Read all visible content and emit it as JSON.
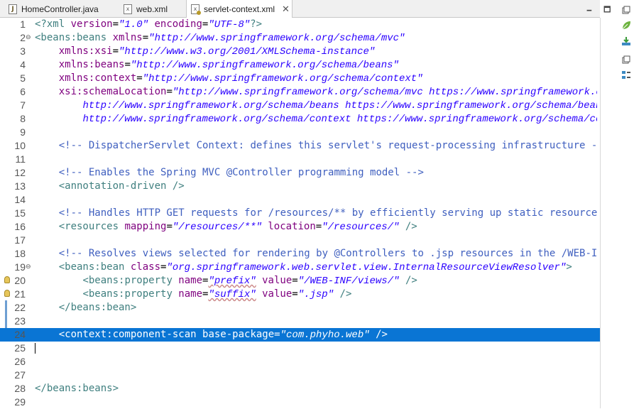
{
  "tabs": [
    {
      "label": "HomeController.java",
      "kind": "java",
      "icon": "java-file-icon"
    },
    {
      "label": "web.xml",
      "kind": "xml",
      "icon": "xml-file-icon"
    },
    {
      "label": "servlet-context.xml",
      "kind": "xml",
      "icon": "xml-file-icon",
      "active": true
    }
  ],
  "window_controls": {
    "minimize": "🗕",
    "maximize": "🗖"
  },
  "lines": [
    {
      "n": "1",
      "seg": [
        [
          "t",
          "<?xml "
        ],
        [
          "a",
          "version"
        ],
        [
          "",
          "="
        ],
        [
          "s",
          "\"1.0\""
        ],
        [
          "a",
          " encoding"
        ],
        [
          "",
          "="
        ],
        [
          "s",
          "\"UTF-8\""
        ],
        [
          "t",
          "?>"
        ]
      ]
    },
    {
      "n": "2",
      "fold": "-",
      "seg": [
        [
          "t",
          "<beans:beans "
        ],
        [
          "a",
          "xmlns"
        ],
        [
          "",
          "="
        ],
        [
          "s",
          "\"http://www.springframework.org/schema/mvc\""
        ]
      ]
    },
    {
      "n": "3",
      "seg": [
        [
          "",
          "    "
        ],
        [
          "a",
          "xmlns:xsi"
        ],
        [
          "",
          "="
        ],
        [
          "s",
          "\"http://www.w3.org/2001/XMLSchema-instance\""
        ]
      ]
    },
    {
      "n": "4",
      "seg": [
        [
          "",
          "    "
        ],
        [
          "a",
          "xmlns:beans"
        ],
        [
          "",
          "="
        ],
        [
          "s",
          "\"http://www.springframework.org/schema/beans\""
        ]
      ]
    },
    {
      "n": "5",
      "seg": [
        [
          "",
          "    "
        ],
        [
          "a",
          "xmlns:context"
        ],
        [
          "",
          "="
        ],
        [
          "s",
          "\"http://www.springframework.org/schema/context\""
        ]
      ]
    },
    {
      "n": "6",
      "seg": [
        [
          "",
          "    "
        ],
        [
          "a",
          "xsi:schemaLocation"
        ],
        [
          "",
          "="
        ],
        [
          "s",
          "\"http://www.springframework.org/schema/mvc https://www.springframework.org/schema/mvc/spring-mvc.xsd"
        ]
      ]
    },
    {
      "n": "7",
      "seg": [
        [
          "",
          "        "
        ],
        [
          "s",
          "http://www.springframework.org/schema/beans https://www.springframework.org/schema/beans/spring-beans.xsd"
        ]
      ]
    },
    {
      "n": "8",
      "seg": [
        [
          "",
          "        "
        ],
        [
          "s",
          "http://www.springframework.org/schema/context https://www.springframework.org/schema/context/spring-context.xsd\""
        ],
        [
          "t",
          ">"
        ]
      ]
    },
    {
      "n": "9",
      "seg": []
    },
    {
      "n": "10",
      "seg": [
        [
          "",
          "    "
        ],
        [
          "c",
          "<!-- DispatcherServlet Context: defines this servlet's request-processing infrastructure -->"
        ]
      ]
    },
    {
      "n": "11",
      "seg": []
    },
    {
      "n": "12",
      "seg": [
        [
          "",
          "    "
        ],
        [
          "c",
          "<!-- Enables the Spring MVC @Controller programming model -->"
        ]
      ]
    },
    {
      "n": "13",
      "seg": [
        [
          "",
          "    "
        ],
        [
          "t",
          "<annotation-driven />"
        ]
      ]
    },
    {
      "n": "14",
      "seg": []
    },
    {
      "n": "15",
      "seg": [
        [
          "",
          "    "
        ],
        [
          "c",
          "<!-- Handles HTTP GET requests for /resources/** by efficiently serving up static resources in the ${webappRoot}/resources directory -->"
        ]
      ]
    },
    {
      "n": "16",
      "seg": [
        [
          "",
          "    "
        ],
        [
          "t",
          "<resources "
        ],
        [
          "a",
          "mapping"
        ],
        [
          "",
          "="
        ],
        [
          "s",
          "\"/resources/**\""
        ],
        [
          "a",
          " location"
        ],
        [
          "",
          "="
        ],
        [
          "s",
          "\"/resources/\""
        ],
        [
          "t",
          " />"
        ]
      ]
    },
    {
      "n": "17",
      "seg": []
    },
    {
      "n": "18",
      "seg": [
        [
          "",
          "    "
        ],
        [
          "c",
          "<!-- Resolves views selected for rendering by @Controllers to .jsp resources in the /WEB-INF/views directory -->"
        ]
      ]
    },
    {
      "n": "19",
      "fold": "-",
      "seg": [
        [
          "",
          "    "
        ],
        [
          "t",
          "<beans:bean "
        ],
        [
          "a",
          "class"
        ],
        [
          "",
          "="
        ],
        [
          "s",
          "\"org.springframework.web.servlet.view.InternalResourceViewResolver\""
        ],
        [
          "t",
          ">"
        ]
      ]
    },
    {
      "n": "20",
      "bulb": true,
      "seg": [
        [
          "",
          "        "
        ],
        [
          "t",
          "<beans:property "
        ],
        [
          "a",
          "name"
        ],
        [
          "",
          "="
        ],
        [
          "s",
          "\"prefix\""
        ],
        [
          "a",
          " value"
        ],
        [
          "",
          "="
        ],
        [
          "s",
          "\"/WEB-INF/views/\""
        ],
        [
          "t",
          " />"
        ]
      ]
    },
    {
      "n": "21",
      "bulb": true,
      "seg": [
        [
          "",
          "        "
        ],
        [
          "t",
          "<beans:property "
        ],
        [
          "a",
          "name"
        ],
        [
          "",
          "="
        ],
        [
          "s",
          "\"suffix\""
        ],
        [
          "a",
          " value"
        ],
        [
          "",
          "="
        ],
        [
          "s",
          "\".jsp\""
        ],
        [
          "t",
          " />"
        ]
      ]
    },
    {
      "n": "22",
      "seg": [
        [
          "",
          "    "
        ],
        [
          "t",
          "</beans:bean>"
        ]
      ]
    },
    {
      "n": "23",
      "seg": []
    },
    {
      "n": "24",
      "sel": true,
      "seg": [
        [
          "",
          "    "
        ],
        [
          "t",
          "<context:component-scan "
        ],
        [
          "a",
          "base-package"
        ],
        [
          "",
          "="
        ],
        [
          "s",
          "\"com.phyho.web\""
        ],
        [
          "t",
          " />"
        ]
      ]
    },
    {
      "n": "25",
      "caret": true,
      "seg": []
    },
    {
      "n": "26",
      "seg": []
    },
    {
      "n": "27",
      "seg": []
    },
    {
      "n": "28",
      "seg": [
        [
          "t",
          "</beans:beans>"
        ]
      ]
    },
    {
      "n": "29",
      "seg": []
    }
  ],
  "right_toolbar": [
    "restore-icon",
    "spring-leaf-icon",
    "download-icon",
    "restore-icon",
    "outline-icon"
  ]
}
